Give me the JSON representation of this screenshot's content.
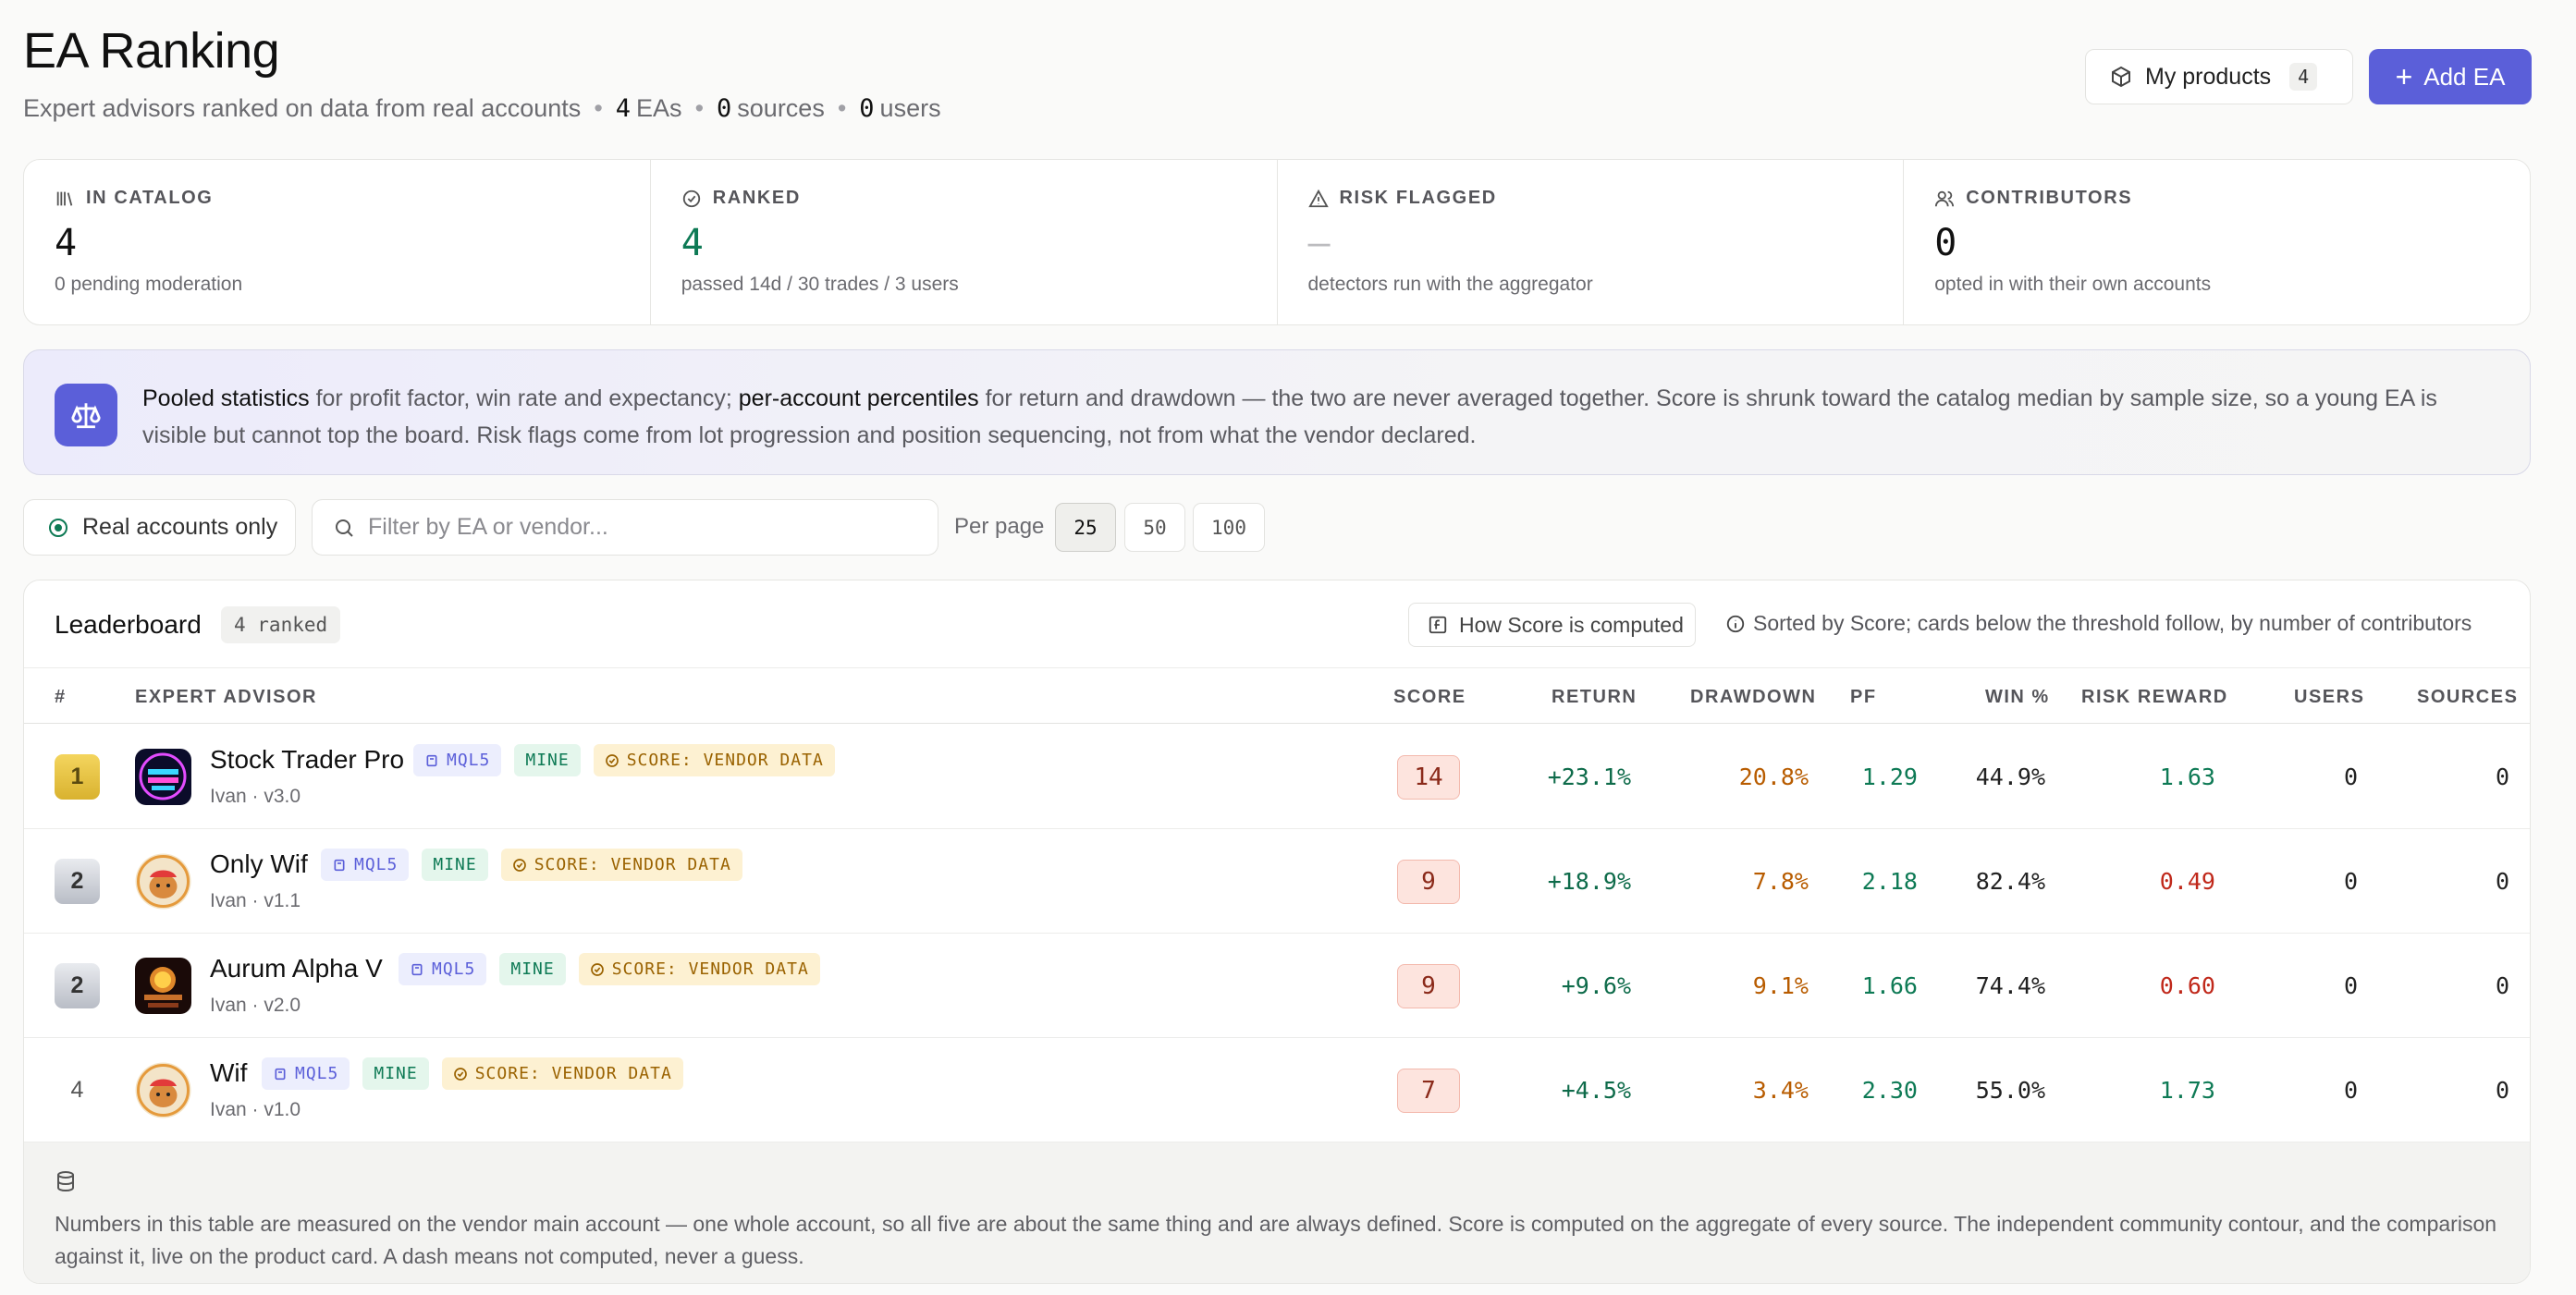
{
  "header": {
    "title": "EA Ranking",
    "subtitle_text": "Expert advisors ranked on data from real accounts",
    "eas_count": "4",
    "eas_label": "EAs",
    "sources_count": "0",
    "sources_label": "sources",
    "users_count": "0",
    "users_label": "users",
    "my_products_label": "My products",
    "my_products_count": "4",
    "add_ea_label": "Add EA"
  },
  "stats": [
    {
      "label": "IN CATALOG",
      "value": "4",
      "sub": "0 pending moderation"
    },
    {
      "label": "RANKED",
      "value": "4",
      "sub": "passed 14d / 30 trades / 3 users"
    },
    {
      "label": "RISK FLAGGED",
      "value": "—",
      "sub": "detectors run with the aggregator"
    },
    {
      "label": "CONTRIBUTORS",
      "value": "0",
      "sub": "opted in with their own accounts"
    }
  ],
  "banner": {
    "b1": "Pooled statistics",
    "t1": " for profit factor, win rate and expectancy; ",
    "b2": "per-account percentiles",
    "t2": " for return and drawdown — the two are never averaged together. Score is shrunk toward the catalog median by sample size, so a young EA is visible but cannot top the board. Risk flags come from lot progression and position sequencing, not from what the vendor declared."
  },
  "filters": {
    "real_accounts_label": "Real accounts only",
    "search_placeholder": "Filter by EA or vendor...",
    "per_page_label": "Per page",
    "per_page_options": [
      "25",
      "50",
      "100"
    ],
    "per_page_selected": "25"
  },
  "leaderboard": {
    "title": "Leaderboard",
    "count_label": "4 ranked",
    "how_score_label": "How Score is computed",
    "sorted_note": "Sorted by Score; cards below the threshold follow, by number of contributors",
    "columns": [
      "#",
      "EXPERT ADVISOR",
      "SCORE",
      "RETURN",
      "DRAWDOWN",
      "PF",
      "WIN %",
      "RISK REWARD",
      "USERS",
      "SOURCES"
    ],
    "rows": [
      {
        "rank": "1",
        "name": "Stock Trader Pro",
        "meta": "Ivan · v3.0",
        "tag_mql": "MQL5",
        "tag_mine": "MINE",
        "tag_vendor": "SCORE: VENDOR DATA",
        "score": "14",
        "return": "+23.1%",
        "drawdown": "20.8%",
        "pf": "1.29",
        "win": "44.9%",
        "rr": "1.63",
        "users": "0",
        "sources": "0"
      },
      {
        "rank": "2",
        "name": "Only Wif",
        "meta": "Ivan · v1.1",
        "tag_mql": "MQL5",
        "tag_mine": "MINE",
        "tag_vendor": "SCORE: VENDOR DATA",
        "score": "9",
        "return": "+18.9%",
        "drawdown": "7.8%",
        "pf": "2.18",
        "win": "82.4%",
        "rr": "0.49",
        "users": "0",
        "sources": "0"
      },
      {
        "rank": "2",
        "name": "Aurum Alpha V",
        "meta": "Ivan · v2.0",
        "tag_mql": "MQL5",
        "tag_mine": "MINE",
        "tag_vendor": "SCORE: VENDOR DATA",
        "score": "9",
        "return": "+9.6%",
        "drawdown": "9.1%",
        "pf": "1.66",
        "win": "74.4%",
        "rr": "0.60",
        "users": "0",
        "sources": "0"
      },
      {
        "rank": "4",
        "name": "Wif",
        "meta": "Ivan · v1.0",
        "tag_mql": "MQL5",
        "tag_mine": "MINE",
        "tag_vendor": "SCORE: VENDOR DATA",
        "score": "7",
        "return": "+4.5%",
        "drawdown": "3.4%",
        "pf": "2.30",
        "win": "55.0%",
        "rr": "1.73",
        "users": "0",
        "sources": "0"
      }
    ],
    "footer_note": "Numbers in this table are measured on the vendor main account — one whole account, so all five are about the same thing and are always defined. Score is computed on the aggregate of every source. The independent community contour, and the comparison against it, live on the product card. A dash means not computed, never a guess."
  },
  "colors": {
    "accent": "#5b5fd9",
    "positive": "#0e7a55",
    "warning": "#b85c00",
    "negative": "#c0281a"
  }
}
